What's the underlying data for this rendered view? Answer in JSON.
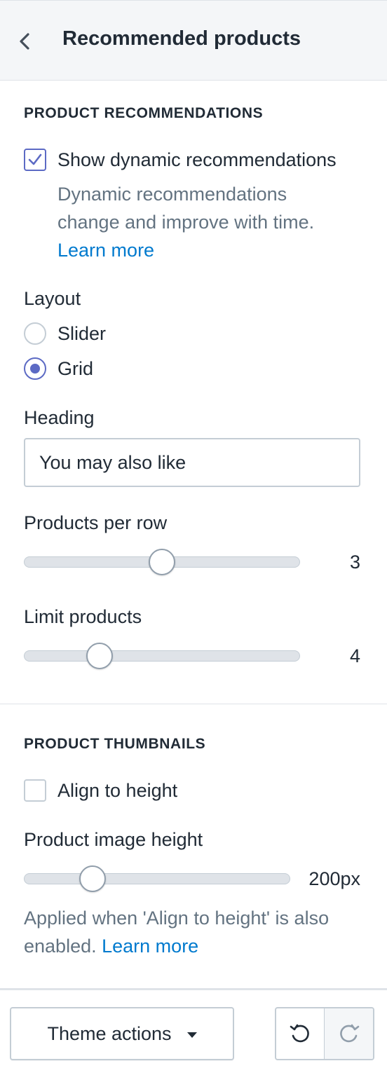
{
  "header": {
    "title": "Recommended products",
    "back_icon": "chevron-left-icon"
  },
  "recommendations": {
    "section_title": "PRODUCT RECOMMENDATIONS",
    "show_dynamic": {
      "label": "Show dynamic recommendations",
      "checked": true,
      "help_line1": "Dynamic recommendations",
      "help_line2": "change and improve with time.",
      "learn_more": "Learn more"
    },
    "layout": {
      "label": "Layout",
      "options": [
        {
          "label": "Slider",
          "selected": false
        },
        {
          "label": "Grid",
          "selected": true
        }
      ]
    },
    "heading": {
      "label": "Heading",
      "value": "You may also like"
    },
    "products_per_row": {
      "label": "Products per row",
      "value": "3",
      "fraction": 0.5
    },
    "limit_products": {
      "label": "Limit products",
      "value": "4",
      "fraction": 0.25
    }
  },
  "thumbnails": {
    "section_title": "PRODUCT THUMBNAILS",
    "align_to_height": {
      "label": "Align to height",
      "checked": false
    },
    "image_height": {
      "label": "Product image height",
      "value": "200px",
      "fraction": 0.23
    },
    "help_line1": "Applied when 'Align to height' is also",
    "help_line2_prefix": "enabled.",
    "learn_more": "Learn more"
  },
  "footer": {
    "theme_actions_label": "Theme actions",
    "undo_icon": "undo-icon",
    "redo_icon": "redo-icon"
  },
  "colors": {
    "accent": "#5c6ac4",
    "link": "#007ace",
    "text": "#212b36",
    "subdued": "#637381"
  }
}
